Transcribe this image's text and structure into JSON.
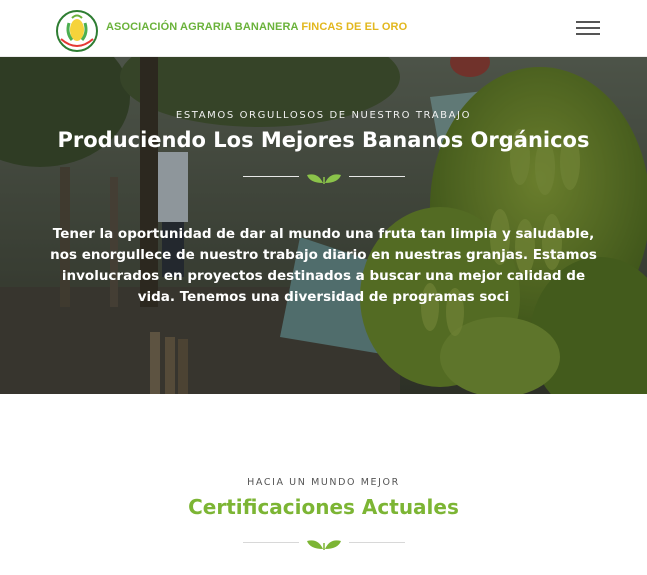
{
  "header": {
    "brand_main": "ASOCIACIÓN AGRARIA BANANERA",
    "brand_sub": "FINCAS DE EL ORO",
    "logo_icon": "association-logo-icon",
    "menu_icon": "hamburger-menu-icon"
  },
  "hero": {
    "kicker": "ESTAMOS ORGULLOSOS DE NUESTRO TRABAJO",
    "title": "Produciendo Los Mejores Bananos Orgánicos",
    "divider_icon": "leaf-icon",
    "text": "Tener la oportunidad de dar al mundo una fruta tan limpia y saludable, nos enorgullece de nuestro trabajo diario en nuestras granjas. Estamos involucrados en proyectos destinados a buscar una mejor calidad de vida. Tenemos una diversidad de programas soci"
  },
  "certifications": {
    "kicker": "HACIA UN MUNDO MEJOR",
    "title": "Certificaciones Actuales",
    "divider_icon": "leaf-icon"
  },
  "colors": {
    "brand_green": "#6ab23a",
    "brand_yellow": "#e2b71e",
    "title_green": "#7cb534"
  }
}
